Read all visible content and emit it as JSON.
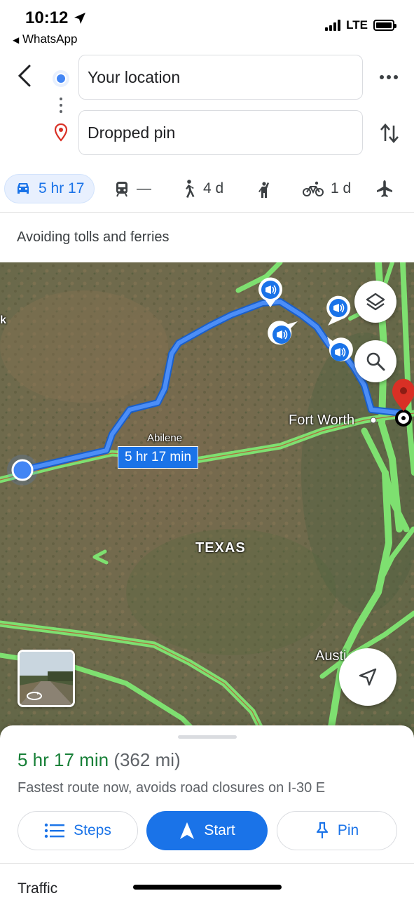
{
  "status": {
    "time": "10:12",
    "back_app": "WhatsApp",
    "network": "LTE"
  },
  "directions": {
    "origin": "Your location",
    "destination": "Dropped pin"
  },
  "modes": {
    "drive": "5 hr 17",
    "transit": "—",
    "walk": "4 d",
    "bike": "1 d"
  },
  "avoid_text": "Avoiding tolls and ferries",
  "map": {
    "labels": {
      "abilene": "Abilene",
      "fort_worth": "Fort Worth",
      "texas": "TEXAS",
      "austin": "Austi",
      "edge": "k"
    },
    "route_chip": "5 hr 17 min"
  },
  "summary": {
    "duration": "5 hr 17 min",
    "distance": "(362 mi)",
    "description": "Fastest route now, avoids road closures on I-30 E"
  },
  "actions": {
    "steps": "Steps",
    "start": "Start",
    "pin": "Pin"
  },
  "traffic_label": "Traffic",
  "colors": {
    "accent": "#1a73e8",
    "duration_green": "#188038",
    "road_green": "#7ee070",
    "pin_red": "#d93025"
  }
}
